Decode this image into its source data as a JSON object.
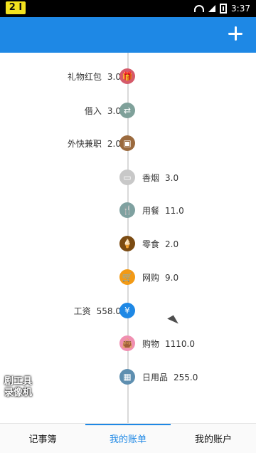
{
  "status_bar": {
    "left_badge": "2 I",
    "time": "3:37"
  },
  "app_bar": {
    "add_label": "+"
  },
  "timeline": {
    "items": [
      {
        "side": "left",
        "label": "礼物红包",
        "amount": "3.0",
        "icon": "gift-icon",
        "color": "#d55a6a"
      },
      {
        "side": "left",
        "label": "借入",
        "amount": "3.0",
        "icon": "exchange-icon",
        "color": "#7fa19a"
      },
      {
        "side": "left",
        "label": "外快兼职",
        "amount": "2.0",
        "icon": "briefcase-icon",
        "color": "#9b6a3e"
      },
      {
        "side": "right",
        "label": "香烟",
        "amount": "3.0",
        "icon": "cigarette-icon",
        "color": "#c8c8c8"
      },
      {
        "side": "right",
        "label": "用餐",
        "amount": "11.0",
        "icon": "utensils-icon",
        "color": "#7fa1a0"
      },
      {
        "side": "right",
        "label": "零食",
        "amount": "2.0",
        "icon": "icecream-icon",
        "color": "#7b4b12"
      },
      {
        "side": "right",
        "label": "网购",
        "amount": "9.0",
        "icon": "shopping-cart-icon",
        "color": "#f29a15"
      },
      {
        "side": "left",
        "label": "工资",
        "amount": "558.0",
        "icon": "yen-icon",
        "color": "#1e88e5"
      },
      {
        "side": "right",
        "label": "购物",
        "amount": "1110.0",
        "icon": "shopping-bag-icon",
        "color": "#f08fb1"
      },
      {
        "side": "right",
        "label": "日用品",
        "amount": "255.0",
        "icon": "daily-items-icon",
        "color": "#5e8fb0"
      }
    ]
  },
  "watermark": {
    "line1": "剧工具",
    "line2": "录像机"
  },
  "bottom_tabs": {
    "notes": "记事簿",
    "bills": "我的账单",
    "account": "我的账户"
  }
}
